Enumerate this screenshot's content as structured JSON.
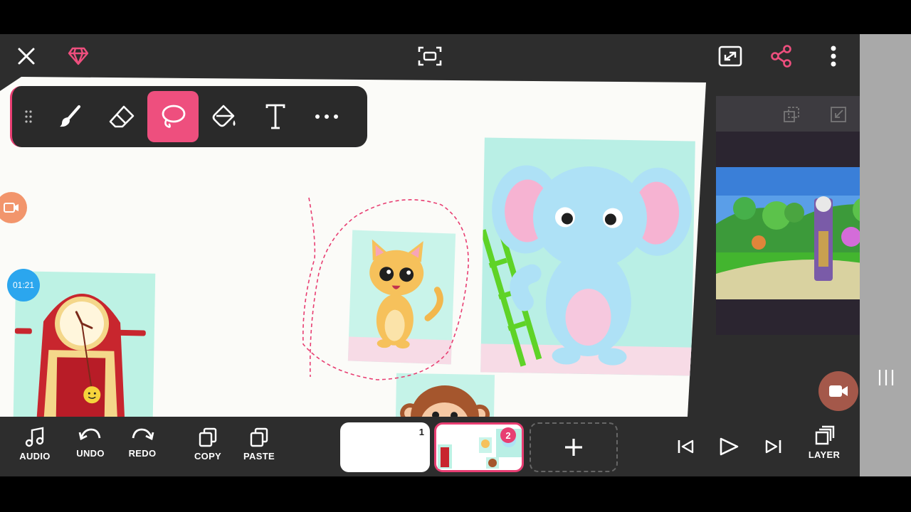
{
  "toolbar_top": {
    "close_icon": "close-icon",
    "premium_icon": "diamond-icon",
    "fit_icon": "fit-screen-icon",
    "expand_icon": "expand-icon",
    "share_icon": "share-icon",
    "menu_icon": "more-vertical-icon"
  },
  "drawing_tools": [
    {
      "name": "brush",
      "icon": "brush-icon"
    },
    {
      "name": "eraser",
      "icon": "eraser-icon"
    },
    {
      "name": "lasso",
      "icon": "lasso-icon",
      "active": true
    },
    {
      "name": "fill",
      "icon": "paint-bucket-icon"
    },
    {
      "name": "text",
      "icon": "text-icon"
    },
    {
      "name": "more",
      "icon": "more-horizontal-icon"
    }
  ],
  "timer": {
    "label": "01:21"
  },
  "bottom": {
    "audio_label": "AUDIO",
    "undo_label": "UNDO",
    "redo_label": "REDO",
    "copy_label": "COPY",
    "paste_label": "PASTE",
    "layer_label": "LAYER"
  },
  "frames": [
    {
      "number": "1"
    },
    {
      "number": "2",
      "selected": true
    }
  ],
  "colors": {
    "accent": "#ee4f7e",
    "timer": "#2ba6ee",
    "record": "#a4584a",
    "toolbar_bg": "#2a2a2a",
    "app_bg": "#2d2d2d"
  }
}
